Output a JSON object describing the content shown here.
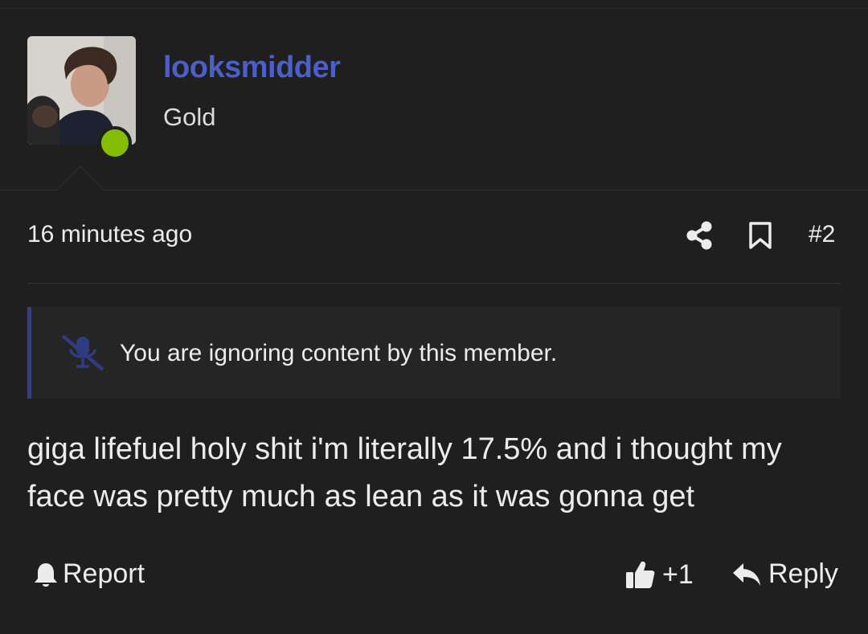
{
  "post": {
    "author": {
      "username": "looksmidder",
      "title": "Gold",
      "status": "online",
      "status_color": "#84bd00",
      "username_color": "#4a5fc7"
    },
    "timestamp": "16 minutes ago",
    "number": "#2",
    "ignore_notice": "You are ignoring content by this member.",
    "message": "giga lifefuel holy shit i'm literally 17.5% and i thought my face was pretty much as lean as it was gonna get",
    "icons": {
      "share": "share-icon",
      "bookmark": "bookmark-icon",
      "ignore": "microphone-slash-icon",
      "report": "bell-icon",
      "like": "thumbs-up-icon",
      "reply": "reply-arrow-icon"
    },
    "actions": {
      "report_label": "Report",
      "like_count": "+1",
      "reply_label": "Reply"
    }
  }
}
